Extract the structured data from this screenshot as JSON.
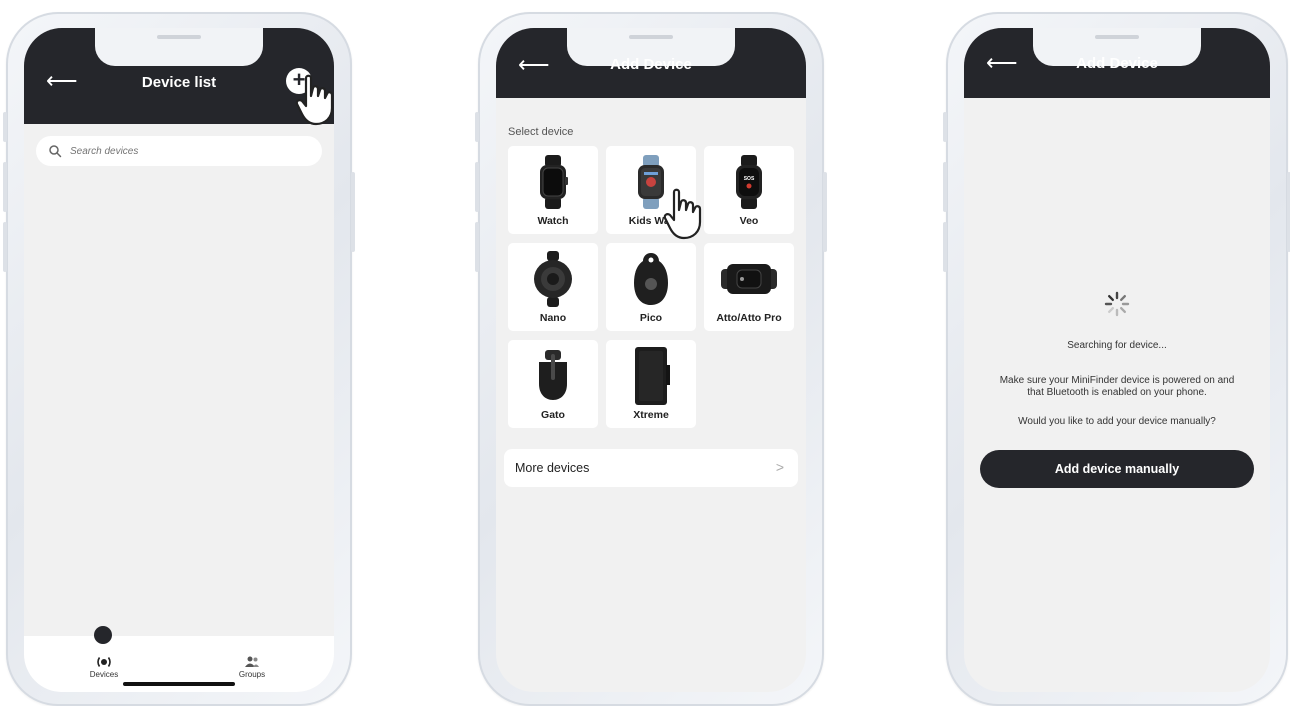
{
  "phone1": {
    "header": {
      "title": "Device list",
      "back_icon": "arrow-left-icon",
      "add_icon": "plus-icon"
    },
    "search": {
      "placeholder": "Search devices"
    },
    "bottom_nav": [
      {
        "label": "Devices",
        "icon": "device-icon"
      },
      {
        "label": "Groups",
        "icon": "groups-icon"
      }
    ]
  },
  "phone2": {
    "header": {
      "title": "Add Device",
      "back_icon": "arrow-left-icon"
    },
    "select_label": "Select device",
    "devices": [
      {
        "label": "Watch"
      },
      {
        "label": "Kids Wat"
      },
      {
        "label": "Veo"
      },
      {
        "label": "Nano"
      },
      {
        "label": "Pico"
      },
      {
        "label": "Atto/Atto Pro"
      },
      {
        "label": "Gato"
      },
      {
        "label": "Xtreme"
      }
    ],
    "more": {
      "label": "More devices",
      "chevron": ">"
    },
    "veo_text": "SOS"
  },
  "phone3": {
    "header": {
      "title": "Add Device",
      "back_icon": "arrow-left-icon"
    },
    "searching": "Searching for device...",
    "info_line1": "Make sure your MiniFinder device is powered on and",
    "info_line2": "that Bluetooth is enabled on your phone.",
    "question": "Would you like to add your device manually?",
    "manual_button": "Add device manually"
  },
  "colors": {
    "dark": "#25262b",
    "background": "#f1f1f1",
    "card": "#ffffff"
  }
}
